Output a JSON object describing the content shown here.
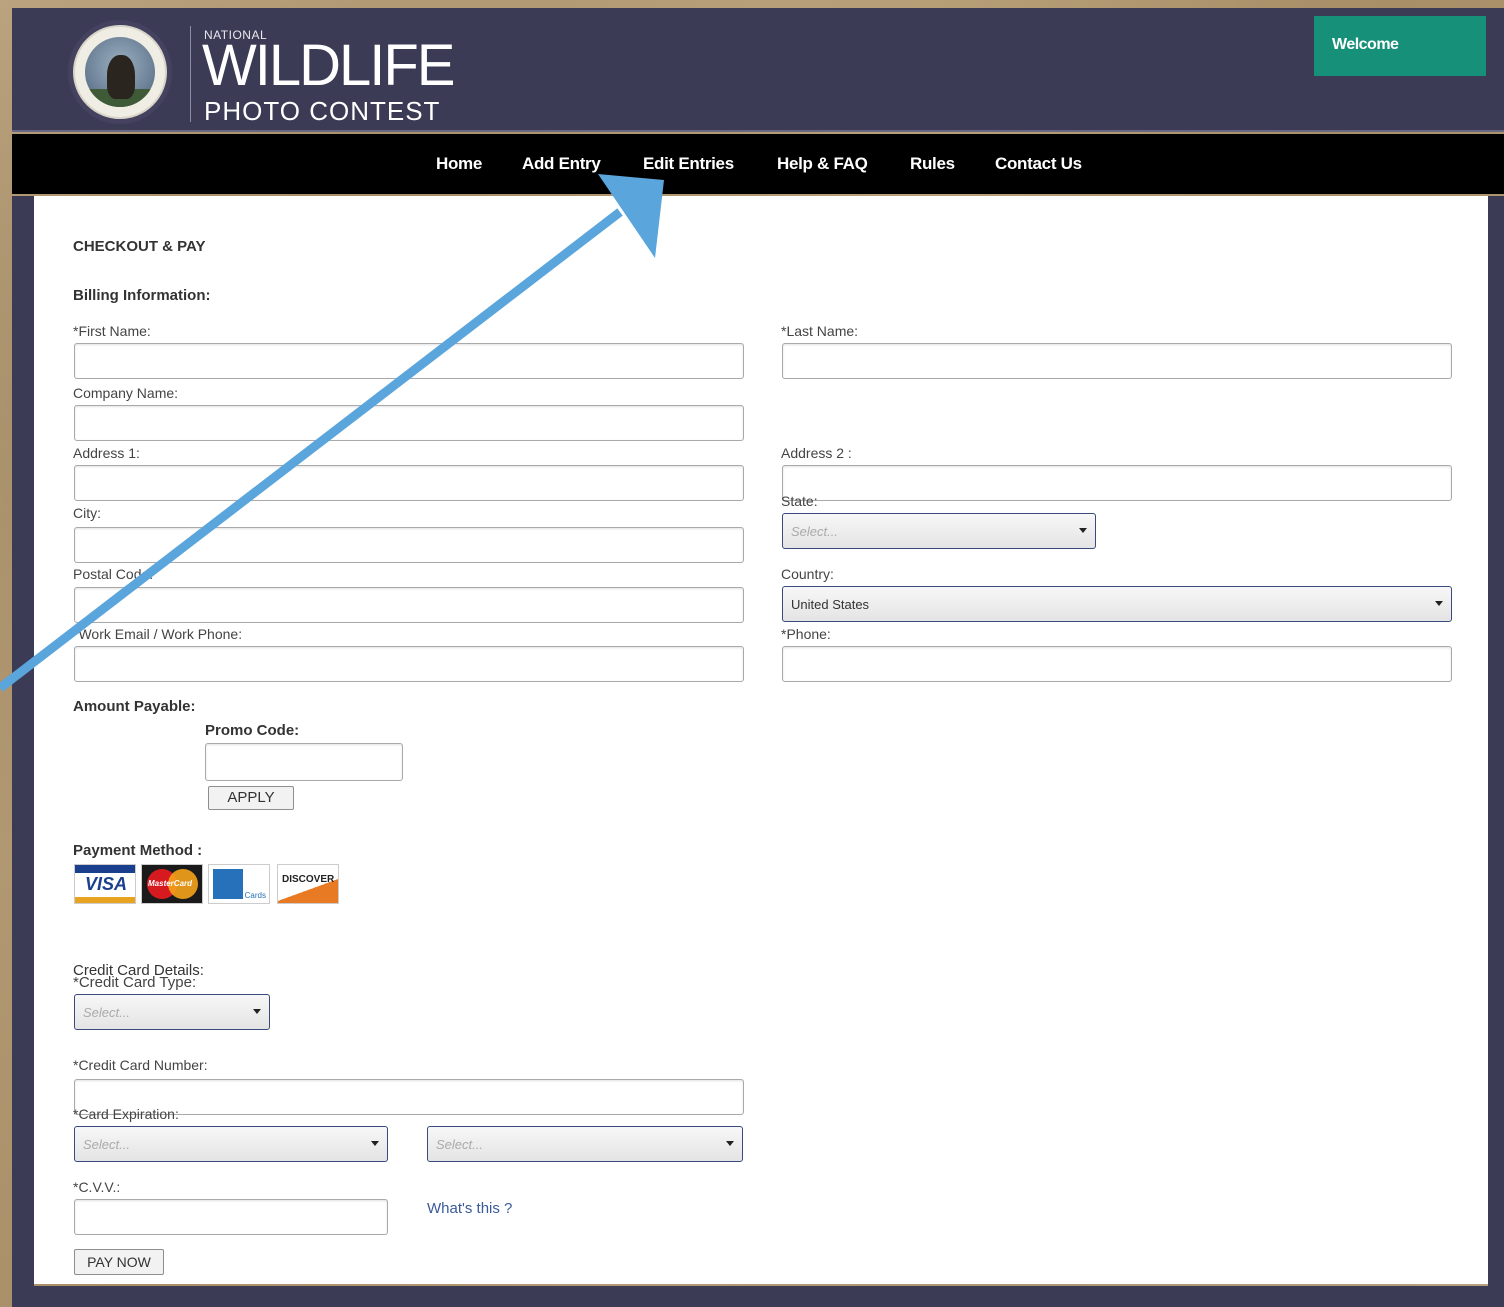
{
  "header": {
    "logo_national": "NATIONAL",
    "logo_wildlife": "WILDLIFE",
    "logo_photo": "PHOTO",
    "logo_contest": "CONTEST",
    "welcome": "Welcome",
    "colors": {
      "header_bg": "#3c3b56",
      "welcome_bg": "#17907a"
    }
  },
  "nav": {
    "items": [
      {
        "label": "Home"
      },
      {
        "label": "Add Entry"
      },
      {
        "label": "Edit Entries"
      },
      {
        "label": "Help & FAQ"
      },
      {
        "label": "Rules"
      },
      {
        "label": "Contact Us"
      }
    ]
  },
  "form": {
    "title": "CHECKOUT & PAY",
    "billing_heading": "Billing Information:",
    "first_name_label": "*First Name:",
    "last_name_label": "*Last Name:",
    "company_label": "Company Name:",
    "address1_label": "Address 1:",
    "address2_label": "Address 2 :",
    "city_label": "City:",
    "state_label": "State:",
    "state_value": "Select...",
    "postal_label": "Postal Code:",
    "country_label": "Country:",
    "country_value": "United States",
    "email_label": "*Work Email / Work Phone:",
    "phone_label": "*Phone:",
    "amount_label": "Amount Payable:",
    "promo_label": "Promo Code:",
    "apply_button": "APPLY",
    "payment_label": "Payment Method :",
    "cards": [
      {
        "name": "VISA",
        "icon": "visa-card-icon"
      },
      {
        "name": "MasterCard",
        "icon": "mastercard-icon"
      },
      {
        "name": "Cards",
        "icon": "amex-card-icon"
      },
      {
        "name": "DISCOVER",
        "icon": "discover-card-icon"
      }
    ],
    "cc_details_label": "Credit Card Details:",
    "cc_type_label": "*Credit Card Type:",
    "cc_type_value": "Select...",
    "cc_number_label": "*Credit Card Number:",
    "expiry_label": "*Card Expiration:",
    "expiry_month_value": "Select...",
    "expiry_year_value": "Select...",
    "cvv_label": "*C.V.V.:",
    "cvv_help_link": "What's this ?",
    "pay_button": "PAY NOW"
  },
  "annotation": {
    "icon": "blue-arrow-annotation",
    "color": "#5aa5dc"
  }
}
